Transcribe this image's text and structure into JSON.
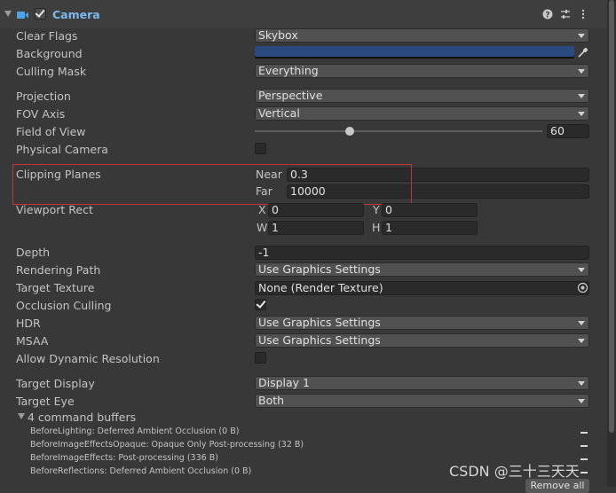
{
  "header": {
    "title": "Camera",
    "enabled": true
  },
  "props": {
    "clear_flags": {
      "label": "Clear Flags",
      "value": "Skybox"
    },
    "background": {
      "label": "Background",
      "color": "#2b4a7e"
    },
    "culling_mask": {
      "label": "Culling Mask",
      "value": "Everything"
    },
    "projection": {
      "label": "Projection",
      "value": "Perspective"
    },
    "fov_axis": {
      "label": "FOV Axis",
      "value": "Vertical"
    },
    "field_of_view": {
      "label": "Field of View",
      "value": "60",
      "slider_fraction": 0.33
    },
    "physical_camera": {
      "label": "Physical Camera",
      "checked": false
    },
    "clipping_planes": {
      "label": "Clipping Planes",
      "near_label": "Near",
      "near": "0.3",
      "far_label": "Far",
      "far": "10000"
    },
    "viewport_rect": {
      "label": "Viewport Rect",
      "x_label": "X",
      "x": "0",
      "y_label": "Y",
      "y": "0",
      "w_label": "W",
      "w": "1",
      "h_label": "H",
      "h": "1"
    },
    "depth": {
      "label": "Depth",
      "value": "-1"
    },
    "rendering_path": {
      "label": "Rendering Path",
      "value": "Use Graphics Settings"
    },
    "target_texture": {
      "label": "Target Texture",
      "value": "None (Render Texture)"
    },
    "occlusion_culling": {
      "label": "Occlusion Culling",
      "checked": true
    },
    "hdr": {
      "label": "HDR",
      "value": "Use Graphics Settings"
    },
    "msaa": {
      "label": "MSAA",
      "value": "Use Graphics Settings"
    },
    "allow_dynamic_resolution": {
      "label": "Allow Dynamic Resolution",
      "checked": false
    },
    "target_display": {
      "label": "Target Display",
      "value": "Display 1"
    },
    "target_eye": {
      "label": "Target Eye",
      "value": "Both"
    }
  },
  "command_buffers": {
    "title": "4 command buffers",
    "items": [
      "BeforeLighting: Deferred Ambient Occlusion (0 B)",
      "BeforeImageEffectsOpaque: Opaque Only Post-processing (32 B)",
      "BeforeImageEffects: Post-processing (336 B)",
      "BeforeReflections: Deferred Ambient Occlusion (0 B)"
    ],
    "remove_all_label": "Remove all"
  },
  "watermark": "CSDN @三十三天天",
  "icons": {
    "fold": "triangle-down-icon",
    "camera": "camera-icon",
    "help": "help-icon",
    "presets": "sliders-icon",
    "menu": "kebab-menu-icon",
    "eyedropper": "eyedropper-icon",
    "object_picker": "object-picker-icon"
  }
}
